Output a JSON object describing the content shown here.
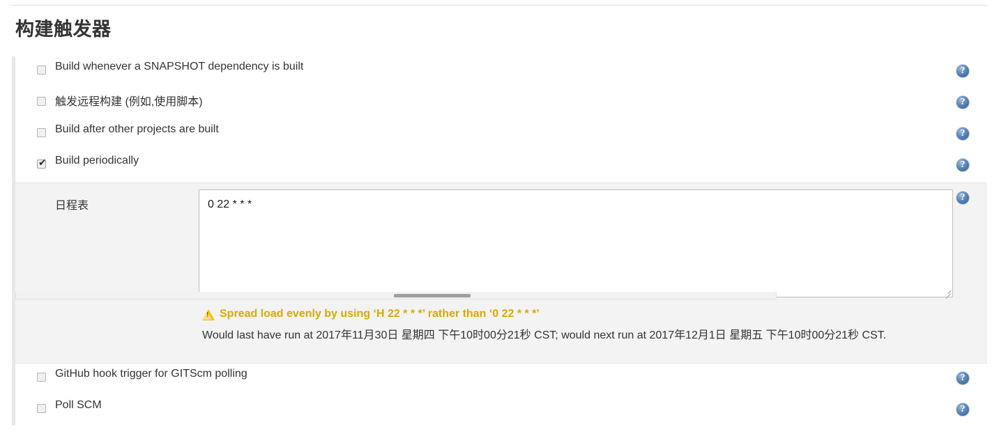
{
  "page": {
    "section_title": "构建触发器"
  },
  "triggers": [
    {
      "label": "Build whenever a SNAPSHOT dependency is built",
      "checked": false,
      "name": "build-whenever-snapshot-dependency-built",
      "help": "?"
    },
    {
      "label": "触发远程构建 (例如,使用脚本)",
      "checked": false,
      "name": "trigger-builds-remotely",
      "help": "?"
    },
    {
      "label": "Build after other projects are built",
      "checked": false,
      "name": "build-after-other-projects",
      "help": "?"
    },
    {
      "label": "Build periodically",
      "checked": true,
      "name": "build-periodically",
      "help": "?"
    },
    {
      "label": "GitHub hook trigger for GITScm polling",
      "checked": false,
      "name": "github-hook-trigger",
      "help": "?"
    },
    {
      "label": "Poll SCM",
      "checked": false,
      "name": "poll-scm",
      "help": "?"
    }
  ],
  "schedule": {
    "label": "日程表",
    "value": "0 22 * * *",
    "placeholder": "",
    "help": "?",
    "warning": "Spread load evenly by using ‘H 22 * * *’ rather than ‘0 22 * * *’",
    "next_run": "Would last have run at 2017年11月30日 星期四 下午10时00分21秒 CST; would next run at 2017年12月1日 星期五 下午10时00分21秒 CST."
  },
  "colors": {
    "warning_text": "#d9a900",
    "warning_icon": "#f2c10e",
    "help_icon": "#2e5f95",
    "panel_background": "#f3f3f3",
    "text": "#333333"
  }
}
